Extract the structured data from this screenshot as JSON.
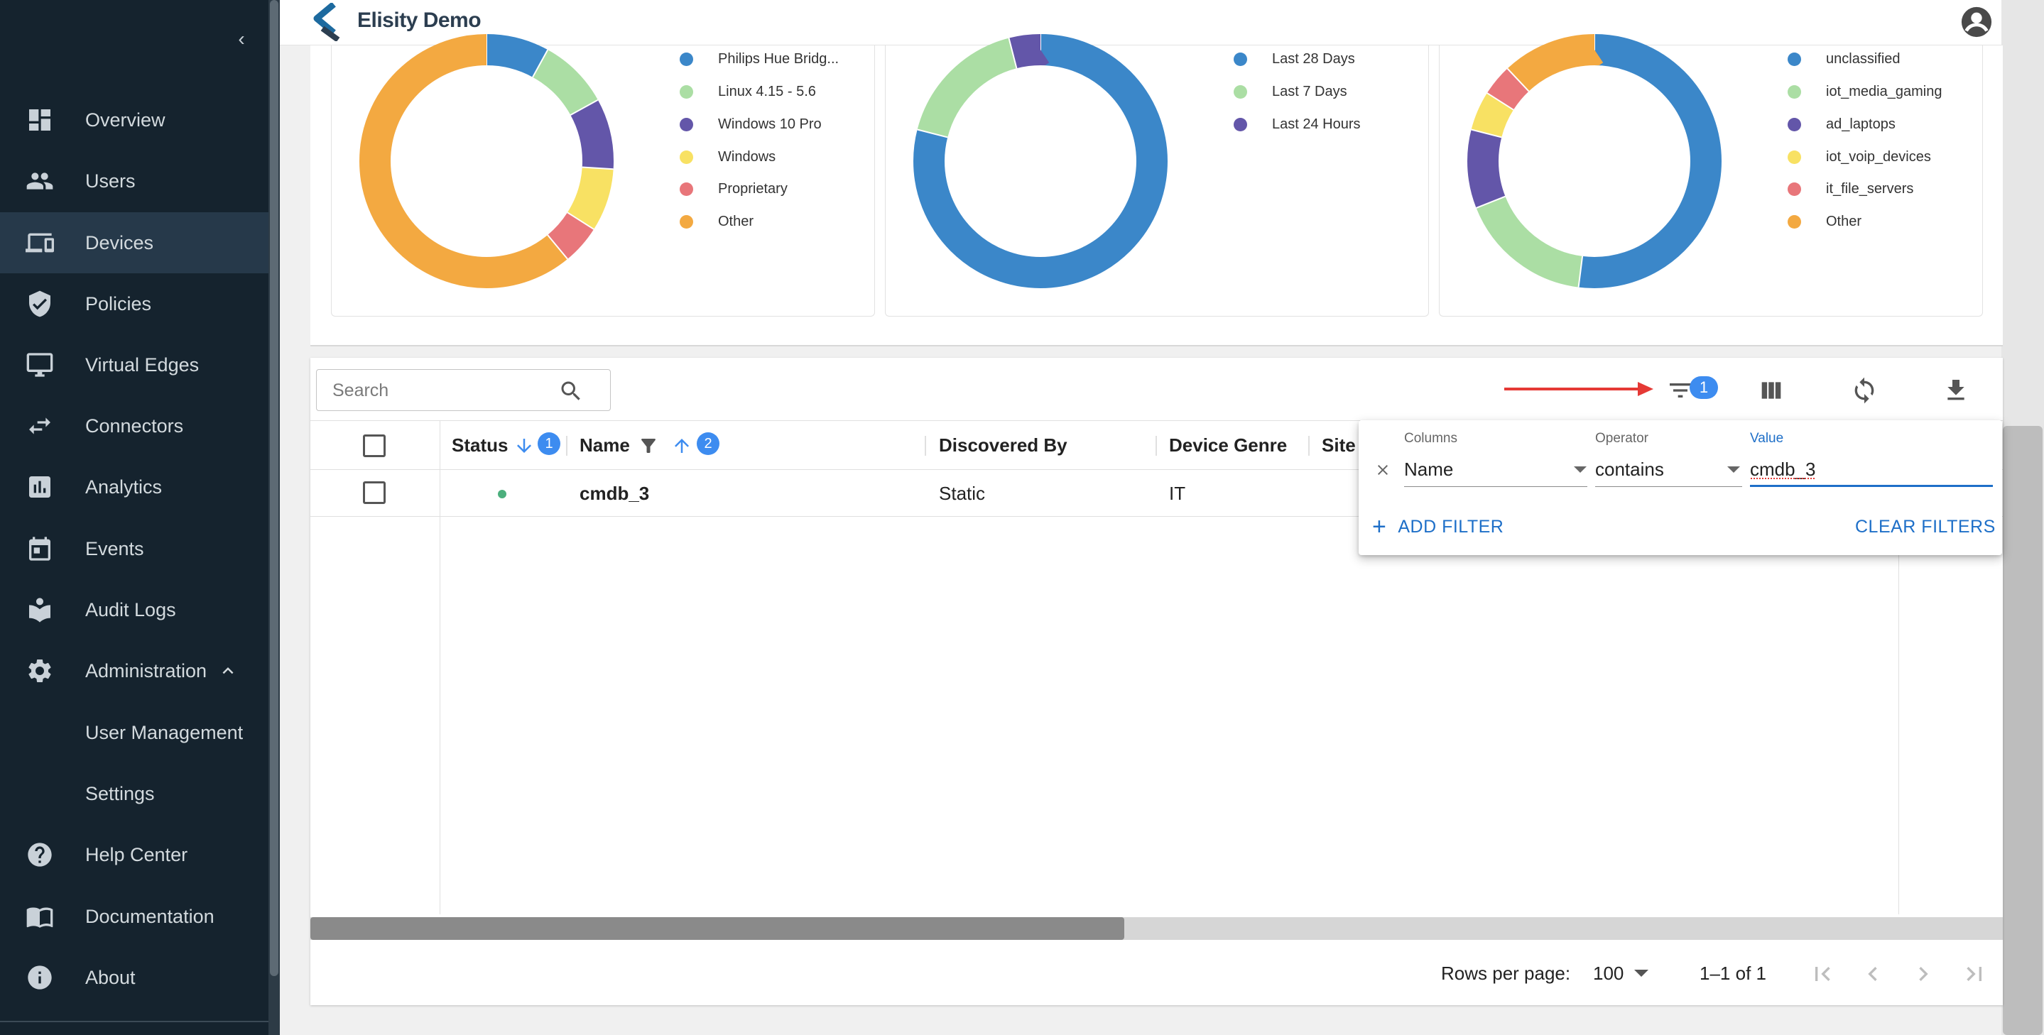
{
  "app": {
    "name": "Elisity Demo"
  },
  "sidebar": {
    "items": [
      {
        "label": "Overview",
        "icon": "dashboard-icon"
      },
      {
        "label": "Users",
        "icon": "users-icon"
      },
      {
        "label": "Devices",
        "icon": "devices-icon",
        "active": true
      },
      {
        "label": "Policies",
        "icon": "shield-icon"
      },
      {
        "label": "Virtual Edges",
        "icon": "monitor-icon"
      },
      {
        "label": "Connectors",
        "icon": "swap-icon"
      },
      {
        "label": "Analytics",
        "icon": "bar-chart-icon"
      },
      {
        "label": "Events",
        "icon": "calendar-icon"
      },
      {
        "label": "Audit Logs",
        "icon": "book-icon"
      },
      {
        "label": "Administration",
        "icon": "gear-icon",
        "expanded": true
      },
      {
        "label": "User Management",
        "sub": true
      },
      {
        "label": "Settings",
        "sub": true
      },
      {
        "label": "Help Center",
        "icon": "help-icon"
      },
      {
        "label": "Documentation",
        "icon": "docs-icon"
      },
      {
        "label": "About",
        "icon": "info-icon"
      }
    ]
  },
  "charts": [
    {
      "legend": [
        "Philips Hue Bridg...",
        "Linux 4.15 - 5.6",
        "Windows 10 Pro",
        "Windows",
        "Proprietary",
        "Other"
      ],
      "colors": [
        "#3b87c9",
        "#abdea4",
        "#6356a9",
        "#f8e163",
        "#e8767a",
        "#f3a941"
      ],
      "values": [
        8,
        9,
        9,
        8,
        5,
        61
      ]
    },
    {
      "legend": [
        "Last 28 Days",
        "Last 7 Days",
        "Last 24 Hours"
      ],
      "colors": [
        "#3b87c9",
        "#abdea4",
        "#6356a9"
      ],
      "values": [
        79,
        17,
        4
      ]
    },
    {
      "legend": [
        "unclassified",
        "iot_media_gaming",
        "ad_laptops",
        "iot_voip_devices",
        "it_file_servers",
        "Other"
      ],
      "colors": [
        "#3b87c9",
        "#abdea4",
        "#6356a9",
        "#f8e163",
        "#e8767a",
        "#f3a941"
      ],
      "values": [
        52,
        17,
        10,
        5,
        4,
        12
      ]
    }
  ],
  "table": {
    "search_placeholder": "Search",
    "filter_count": "1",
    "columns": [
      "Status",
      "Name",
      "Discovered By",
      "Device Genre",
      "Site"
    ],
    "status_sort_badge": "1",
    "name_sort_badge": "2",
    "rows": [
      {
        "status": "online",
        "name": "cmdb_3",
        "discovered_by": "Static",
        "device_genre": "IT",
        "site": ""
      }
    ]
  },
  "filter_panel": {
    "columns_label": "Columns",
    "operator_label": "Operator",
    "value_label": "Value",
    "column_value": "Name",
    "operator_value": "contains",
    "filter_value": "cmdb_3",
    "add_filter": "ADD FILTER",
    "clear_filters": "CLEAR FILTERS"
  },
  "pagination": {
    "rows_per_page_label": "Rows per page:",
    "rows_per_page": "100",
    "range": "1–1 of 1"
  }
}
